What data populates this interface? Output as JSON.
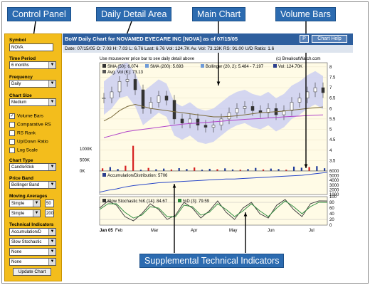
{
  "callouts": {
    "control_panel": "Control Panel",
    "daily_detail": "Daily Detail Area",
    "main_chart": "Main Chart",
    "volume_bars": "Volume Bars",
    "supplemental": "Supplemental Technical Indicators"
  },
  "panel": {
    "symbol_label": "Symbol",
    "symbol_value": "NOVA",
    "time_period_label": "Time Period",
    "time_period_value": "6 months",
    "frequency_label": "Frequency",
    "frequency_value": "Daily",
    "chart_size_label": "Chart Size",
    "chart_size_value": "Medium",
    "checkboxes": [
      {
        "label": "Volume Bars",
        "checked": true
      },
      {
        "label": "Comparative RS",
        "checked": false
      },
      {
        "label": "RS Rank",
        "checked": false
      },
      {
        "label": "Up/Down Ratio",
        "checked": false
      },
      {
        "label": "Log Scale",
        "checked": false
      }
    ],
    "chart_type_label": "Chart Type",
    "chart_type_value": "CandleStick",
    "price_band_label": "Price Band",
    "price_band_value": "Bollinger Band",
    "moving_averages_label": "Moving Averages",
    "ma1_type": "Simple",
    "ma1_period": "50",
    "ma2_type": "Simple",
    "ma2_period": "200",
    "technical_indicators_label": "Technical Indicators",
    "indicator1": "Accumulation/D",
    "indicator2": "Slow Stochastic",
    "indicator3": "None",
    "indicator4": "None",
    "update_button": "Update Chart"
  },
  "header": {
    "title": "BoW Daily Chart for NOVAMED EYECARE INC [NOVA] as of 07/15/05",
    "btn_print": "P",
    "btn_help": "Chart Help"
  },
  "stats_line": "Date: 07/15/05  O: 7.03  H: 7.03  L: 6.76  Last: 6.76  Vol: 124.7K  Av. Vol: 73.13K  RS: 91.00  U/D Ratio: 1.6",
  "chart_notes": {
    "mouseover": "Use mouseover price bar to see daily detail above",
    "copyright": "(c) BreakoutWatch.com"
  },
  "chart_data": [
    {
      "type": "line",
      "title": "Price",
      "legend": [
        "SMA (50): 6.074",
        "SMA (200): 5.693",
        "Bollinger (20, 2): 5.484 - 7.197",
        "Vol: 124.70K",
        "Avg. Vol (K): 73.13"
      ],
      "x": [
        "Jan 05",
        "Feb",
        "Mar",
        "Apr",
        "May",
        "Jun",
        "Jul"
      ],
      "ylim": [
        3,
        8.2
      ],
      "yticks": [
        "8",
        "7.5",
        "7",
        "6.5",
        "6",
        "5.5",
        "5",
        "4.5",
        "4",
        "3.5"
      ],
      "close": [
        6.5,
        6.8,
        7.3,
        7.4,
        6.9,
        6.0,
        6.3,
        6.6,
        6.4,
        5.5,
        5.3,
        5.5,
        5.2,
        5.1,
        5.2,
        5.5,
        5.8,
        6.0,
        6.1,
        5.9,
        5.8,
        6.0,
        5.7,
        5.9,
        6.3,
        6.5,
        6.8,
        7.0,
        6.76
      ],
      "sma50": [
        5.4,
        5.6,
        5.9,
        6.1,
        6.2,
        6.1,
        6.0,
        5.95,
        5.9,
        5.85,
        5.8,
        5.75,
        5.7,
        5.65,
        5.6,
        5.6,
        5.62,
        5.65,
        5.7,
        5.75,
        5.8,
        5.82,
        5.85,
        5.88,
        5.92,
        5.96,
        6.0,
        6.04,
        6.074
      ],
      "sma200": [
        4.6,
        4.7,
        4.8,
        4.9,
        4.95,
        5.0,
        5.05,
        5.1,
        5.15,
        5.2,
        5.25,
        5.28,
        5.3,
        5.33,
        5.36,
        5.39,
        5.42,
        5.45,
        5.48,
        5.5,
        5.52,
        5.55,
        5.57,
        5.6,
        5.62,
        5.64,
        5.66,
        5.68,
        5.693
      ]
    },
    {
      "type": "bar",
      "title": "Volume",
      "yticks": [
        "1000K",
        "500K",
        "0K"
      ],
      "ylim": [
        0,
        1300
      ],
      "values": [
        120,
        180,
        90,
        240,
        1150,
        60,
        140,
        80,
        110,
        70,
        130,
        90,
        160,
        60,
        100,
        80,
        120,
        70,
        60,
        90,
        140,
        70,
        110,
        90,
        60,
        200,
        150,
        180,
        220,
        125
      ]
    },
    {
      "type": "line",
      "title": "Accumulation/Distribution",
      "legend": [
        "Accumulation/Distribution: 5706"
      ],
      "ylim": [
        1000,
        6000
      ],
      "yticks": [
        "6000",
        "5000",
        "4000",
        "3000",
        "2000",
        "1000"
      ],
      "values": [
        1500,
        1900,
        2200,
        2600,
        2900,
        3100,
        3300,
        3500,
        3600,
        3700,
        3800,
        3900,
        4000,
        4100,
        4200,
        4300,
        4300,
        4400,
        4500,
        4600,
        4700,
        4800,
        4900,
        5000,
        5100,
        5300,
        5500,
        5706
      ]
    },
    {
      "type": "line",
      "title": "Slow Stochastic",
      "legend": [
        "Slow Stochastic %K (14): 84.67",
        "%D (3): 79.59"
      ],
      "ylim": [
        0,
        100
      ],
      "yticks": [
        "100",
        "80",
        "60",
        "40",
        "20",
        "0"
      ],
      "k": [
        60,
        85,
        70,
        30,
        15,
        40,
        75,
        55,
        20,
        35,
        80,
        60,
        25,
        50,
        85,
        45,
        20,
        60,
        80,
        40,
        25,
        70,
        90,
        55,
        30,
        75,
        85,
        84.67
      ],
      "d": [
        55,
        75,
        75,
        45,
        25,
        35,
        65,
        60,
        30,
        30,
        70,
        65,
        35,
        45,
        75,
        55,
        30,
        50,
        75,
        50,
        30,
        60,
        85,
        65,
        40,
        65,
        80,
        79.59
      ]
    }
  ]
}
